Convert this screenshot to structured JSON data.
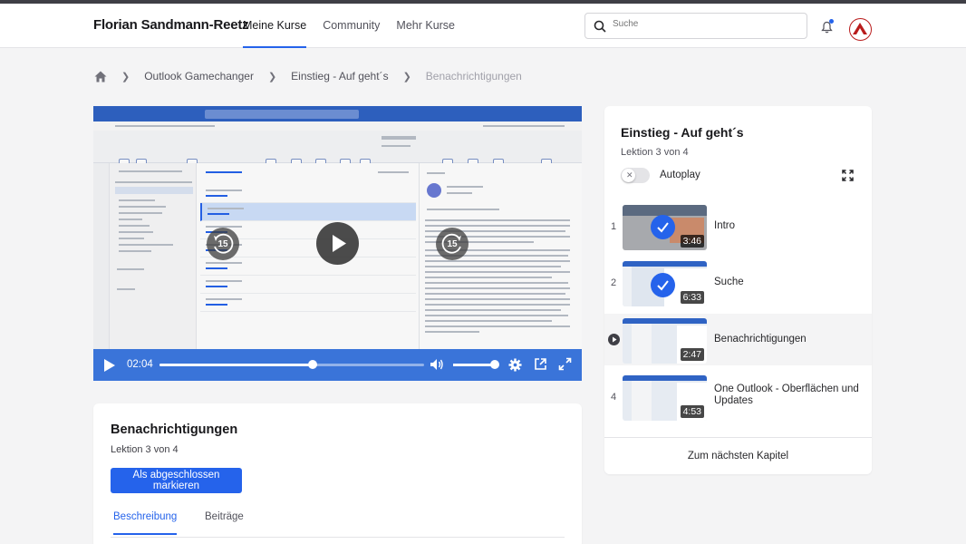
{
  "header": {
    "brand": "Florian Sandmann-Reetz",
    "nav": [
      "Meine Kurse",
      "Community",
      "Mehr Kurse"
    ],
    "search_placeholder": "Suche"
  },
  "breadcrumb": [
    "Outlook Gamechanger",
    "Einstieg - Auf geht´s",
    "Benachrichtigungen"
  ],
  "video": {
    "current_time": "02:04",
    "progress": 0.58,
    "volume": 1.0,
    "skip_seconds": "15"
  },
  "lesson_card": {
    "title": "Benachrichtigungen",
    "subtitle": "Lektion 3 von 4",
    "complete_button": "Als abgeschlossen markieren",
    "tabs": [
      "Beschreibung",
      "Beiträge"
    ]
  },
  "chapter": {
    "title": "Einstieg - Auf geht´s",
    "progress": "Lektion 3 von 4",
    "autoplay_label": "Autoplay",
    "lessons": [
      {
        "num": "1",
        "title": "Intro",
        "duration": "3:46"
      },
      {
        "num": "2",
        "title": "Suche",
        "duration": "6:33"
      },
      {
        "num": "3",
        "title": "Benachrichtigungen",
        "duration": "2:47"
      },
      {
        "num": "4",
        "title": "One Outlook - Oberflächen und Updates",
        "duration": "4:53"
      }
    ],
    "next_button": "Zum nächsten Kapitel"
  }
}
